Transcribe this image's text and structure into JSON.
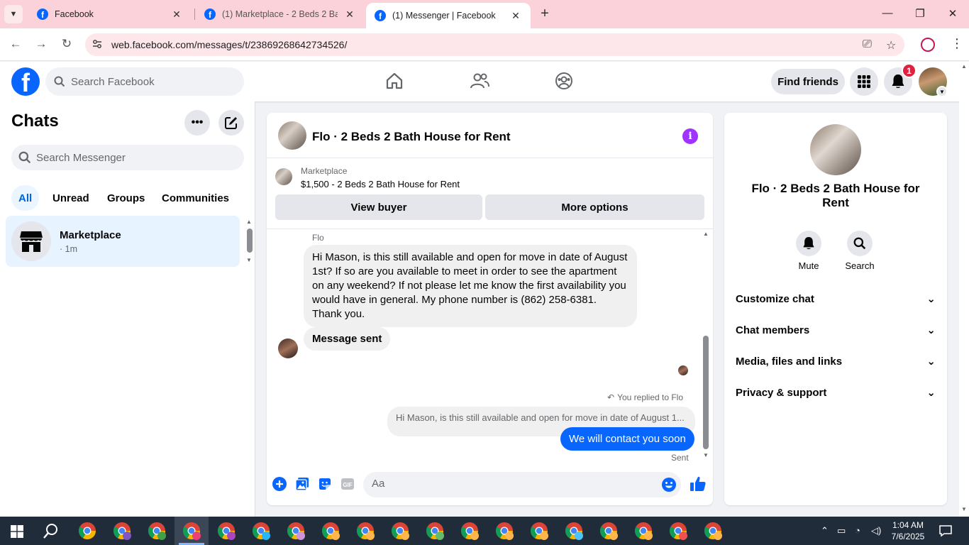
{
  "browser": {
    "tabs": [
      {
        "title": "Facebook",
        "active": false
      },
      {
        "title": "(1) Marketplace - 2 Beds 2 Bath",
        "active": false
      },
      {
        "title": "(1) Messenger | Facebook",
        "active": true
      }
    ],
    "url": "web.facebook.com/messages/t/23869268642734526/"
  },
  "fb_nav": {
    "logo_letter": "f",
    "search_placeholder": "Search Facebook",
    "find_friends_label": "Find friends",
    "notification_count": "1"
  },
  "sidebar": {
    "title": "Chats",
    "search_placeholder": "Search Messenger",
    "filters": [
      "All",
      "Unread",
      "Groups",
      "Communities"
    ],
    "chats": [
      {
        "name": "Marketplace",
        "subtitle": "· 1m"
      }
    ]
  },
  "conversation": {
    "title": "Flo · 2 Beds 2 Bath House for Rent",
    "marketplace_label": "Marketplace",
    "listing": "$1,500 - 2 Beds 2 Bath House for Rent",
    "view_buyer_label": "View buyer",
    "more_options_label": "More options",
    "sender_name": "Flo",
    "incoming_message": "Hi Mason,  is this still available and open for move in date of August 1st? If so are you available to meet in order to see the apartment on any weekend? If not please let me know the first availability you would have in general. My phone number is (862) 258-6381. Thank you.",
    "incoming_status": "Message sent",
    "replied_label": "You replied to Flo",
    "quoted_text": "Hi Mason,  is this still available and open for move in date of August 1...",
    "outgoing_message": "We will contact you soon",
    "outgoing_status": "Sent",
    "composer_placeholder": "Aa"
  },
  "info_panel": {
    "name": "Flo · 2 Beds 2 Bath House for Rent",
    "actions": [
      {
        "label": "Mute",
        "icon": "bell-icon"
      },
      {
        "label": "Search",
        "icon": "search-icon"
      }
    ],
    "sections": [
      "Customize chat",
      "Chat members",
      "Media, files and links",
      "Privacy & support"
    ]
  },
  "taskbar": {
    "time": "1:04 AM",
    "date": "7/6/2025"
  },
  "colors": {
    "facebook_blue": "#0866ff",
    "accent_purple": "#a033ff",
    "tab_bar_pink": "#fbd2da",
    "notification_red": "#e41e3f"
  }
}
